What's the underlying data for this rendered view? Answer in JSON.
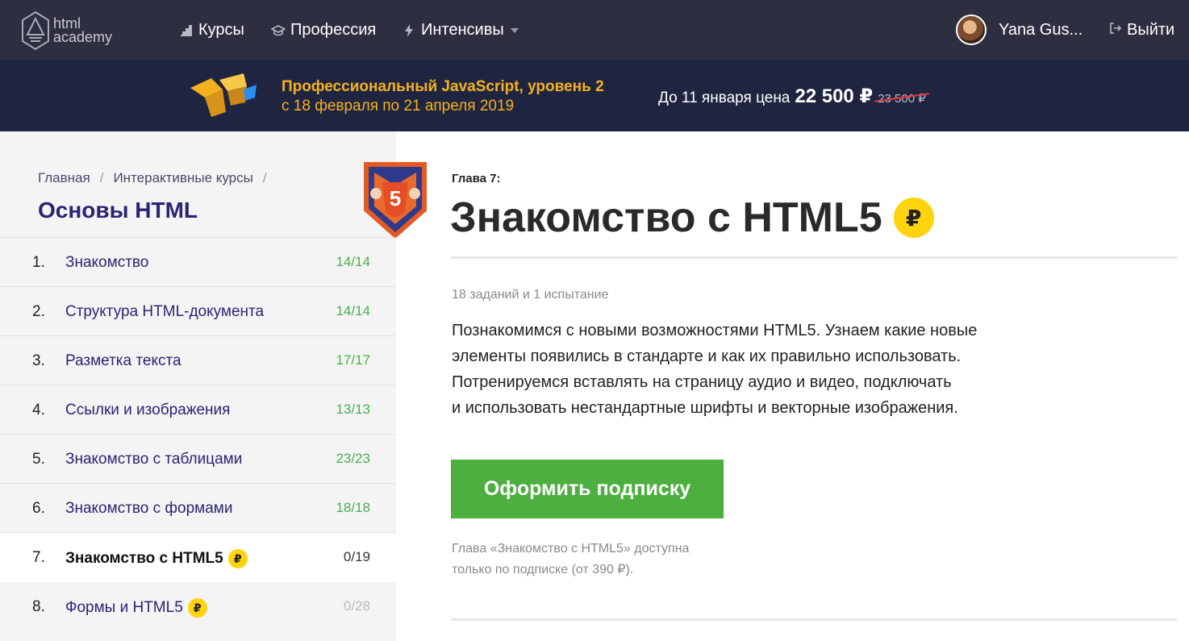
{
  "header": {
    "logo_text_1": "html",
    "logo_text_2": "academy",
    "nav": [
      {
        "label": "Курсы",
        "icon": "stairs-icon"
      },
      {
        "label": "Профессия",
        "icon": "graduation-cap-icon"
      },
      {
        "label": "Интенсивы",
        "icon": "lightning-icon",
        "has_dropdown": true
      }
    ],
    "user_name": "Yana Gus...",
    "logout_label": "Выйти"
  },
  "promo": {
    "title": "Профессиональный JavaScript, уровень 2",
    "dates": "с 18 февраля по 21 апреля 2019",
    "price_label": "До 11 января цена",
    "price": "22 500 ₽",
    "old_price": "23 500 ₽"
  },
  "sidebar": {
    "breadcrumb": [
      "Главная",
      "Интерактивные курсы"
    ],
    "breadcrumb_sep": "/",
    "course_title": "Основы HTML",
    "chapters": [
      {
        "num": "1.",
        "title": "Знакомство",
        "progress": "14/14",
        "paid": false,
        "state": "done"
      },
      {
        "num": "2.",
        "title": "Структура HTML-документа",
        "progress": "14/14",
        "paid": false,
        "state": "done"
      },
      {
        "num": "3.",
        "title": "Разметка текста",
        "progress": "17/17",
        "paid": false,
        "state": "done"
      },
      {
        "num": "4.",
        "title": "Ссылки и изображения",
        "progress": "13/13",
        "paid": false,
        "state": "done"
      },
      {
        "num": "5.",
        "title": "Знакомство с таблицами",
        "progress": "23/23",
        "paid": false,
        "state": "done"
      },
      {
        "num": "6.",
        "title": "Знакомство с формами",
        "progress": "18/18",
        "paid": false,
        "state": "done"
      },
      {
        "num": "7.",
        "title": "Знакомство с HTML5",
        "progress": "0/19",
        "paid": true,
        "state": "active"
      },
      {
        "num": "8.",
        "title": "Формы и HTML5",
        "progress": "0/28",
        "paid": true,
        "state": "locked"
      }
    ]
  },
  "main": {
    "chapter_label": "Глава 7:",
    "title": "Знакомство с HTML5",
    "meta": "18 заданий и 1 испытание",
    "description": [
      "Познакомимся с новыми возможностями HTML5. Узнаем какие новые",
      "элементы появились в стандарте и как их правильно использовать.",
      "Потренируемся вставлять на страницу аудио и видео, подключать",
      "и использовать нестандартные шрифты и векторные изображения."
    ],
    "subscribe_label": "Оформить подписку",
    "note": [
      "Глава «Знакомство с HTML5» доступна",
      "только по подписке (от 390 ₽)."
    ],
    "ruble_symbol": "₽",
    "badge_number": "5"
  },
  "colors": {
    "topbar": "#2d2f41",
    "promo_bg": "#1f2540",
    "promo_accent": "#f5b11d",
    "title_blue": "#2a2472",
    "progress_green": "#4caf50",
    "button_green": "#4caf3f",
    "ruble_yellow": "#ffd30d"
  }
}
